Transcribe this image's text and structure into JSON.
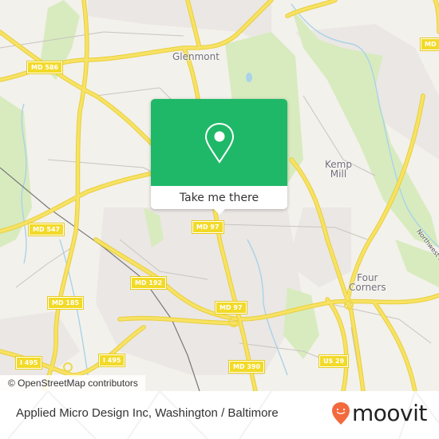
{
  "map": {
    "place_labels": [
      {
        "name": "glenmont",
        "text": "Glenmont"
      },
      {
        "name": "kemp-mill",
        "text": "Kemp\nMill"
      },
      {
        "name": "four-corners",
        "text": "Four\nCorners"
      },
      {
        "name": "northwest-branch",
        "text": "Northwest Branch"
      }
    ],
    "road_shields": [
      {
        "name": "md-586",
        "text": "MD 586"
      },
      {
        "name": "md-547",
        "text": "MD 547"
      },
      {
        "name": "md-97-north",
        "text": "MD 97"
      },
      {
        "name": "md-192",
        "text": "MD 192"
      },
      {
        "name": "md-185",
        "text": "MD 185"
      },
      {
        "name": "md-97-south",
        "text": "MD 97"
      },
      {
        "name": "i-495-west",
        "text": "I 495"
      },
      {
        "name": "i-495-east",
        "text": "I 495"
      },
      {
        "name": "md-390",
        "text": "MD 390"
      },
      {
        "name": "us-29",
        "text": "US 29"
      },
      {
        "name": "md-edge",
        "text": "MD"
      }
    ],
    "attribution": "© OpenStreetMap contributors",
    "colors": {
      "land": "#f3f1ec",
      "park": "#d8ebbf",
      "residential": "#ebe7e4",
      "road_major": "#f7e264",
      "water": "#a9d3e8",
      "shield": "#f2da28"
    }
  },
  "popup": {
    "icon": "map-pin-icon",
    "button_label": "Take me there",
    "color": "#1fb868"
  },
  "footer": {
    "title": "Applied Micro Design Inc, Washington / Baltimore",
    "brand": "moovit",
    "brand_icon": "moovit-smile-pin-icon",
    "brand_color": "#f26a3d"
  }
}
